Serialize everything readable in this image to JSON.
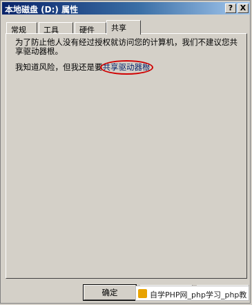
{
  "window": {
    "title": "本地磁盘 (D:) 属性",
    "help_label": "?",
    "close_label": "X"
  },
  "tabs": [
    {
      "label": "常规"
    },
    {
      "label": "工具"
    },
    {
      "label": "硬件"
    },
    {
      "label": "共享"
    }
  ],
  "sharing": {
    "warning": "为了防止他人没有经过授权就访问您的计算机，我们不建议您共享驱动器根。",
    "risk_prefix": "我知道风险，但我还是要",
    "share_link": "共享驱动器根"
  },
  "buttons": {
    "ok": "确定"
  },
  "watermark": {
    "text": "自学PHP网_php学习_php教"
  }
}
